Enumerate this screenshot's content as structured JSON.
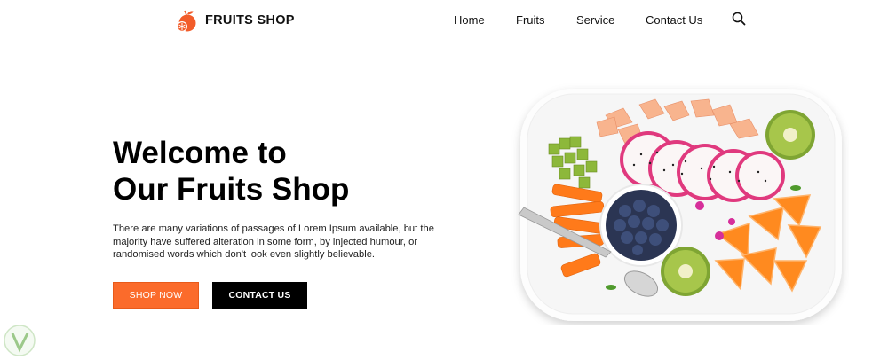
{
  "header": {
    "brand": "FRUITS SHOP",
    "nav": [
      "Home",
      "Fruits",
      "Service",
      "Contact Us"
    ]
  },
  "hero": {
    "title_line1": "Welcome to",
    "title_line2": "Our Fruits Shop",
    "text": "There are many variations of passages of Lorem Ipsum available, but the majority have suffered alteration in some form, by injected humour, or randomised words which don't look even slightly believable.",
    "shop_button": "SHOP NOW",
    "contact_button": "CONTACT US"
  },
  "colors": {
    "accent": "#fb6b2b",
    "dark": "#000000"
  },
  "icons": {
    "logo": "fruit-logo-icon",
    "search": "search-icon",
    "watermark": "v-badge-icon"
  }
}
